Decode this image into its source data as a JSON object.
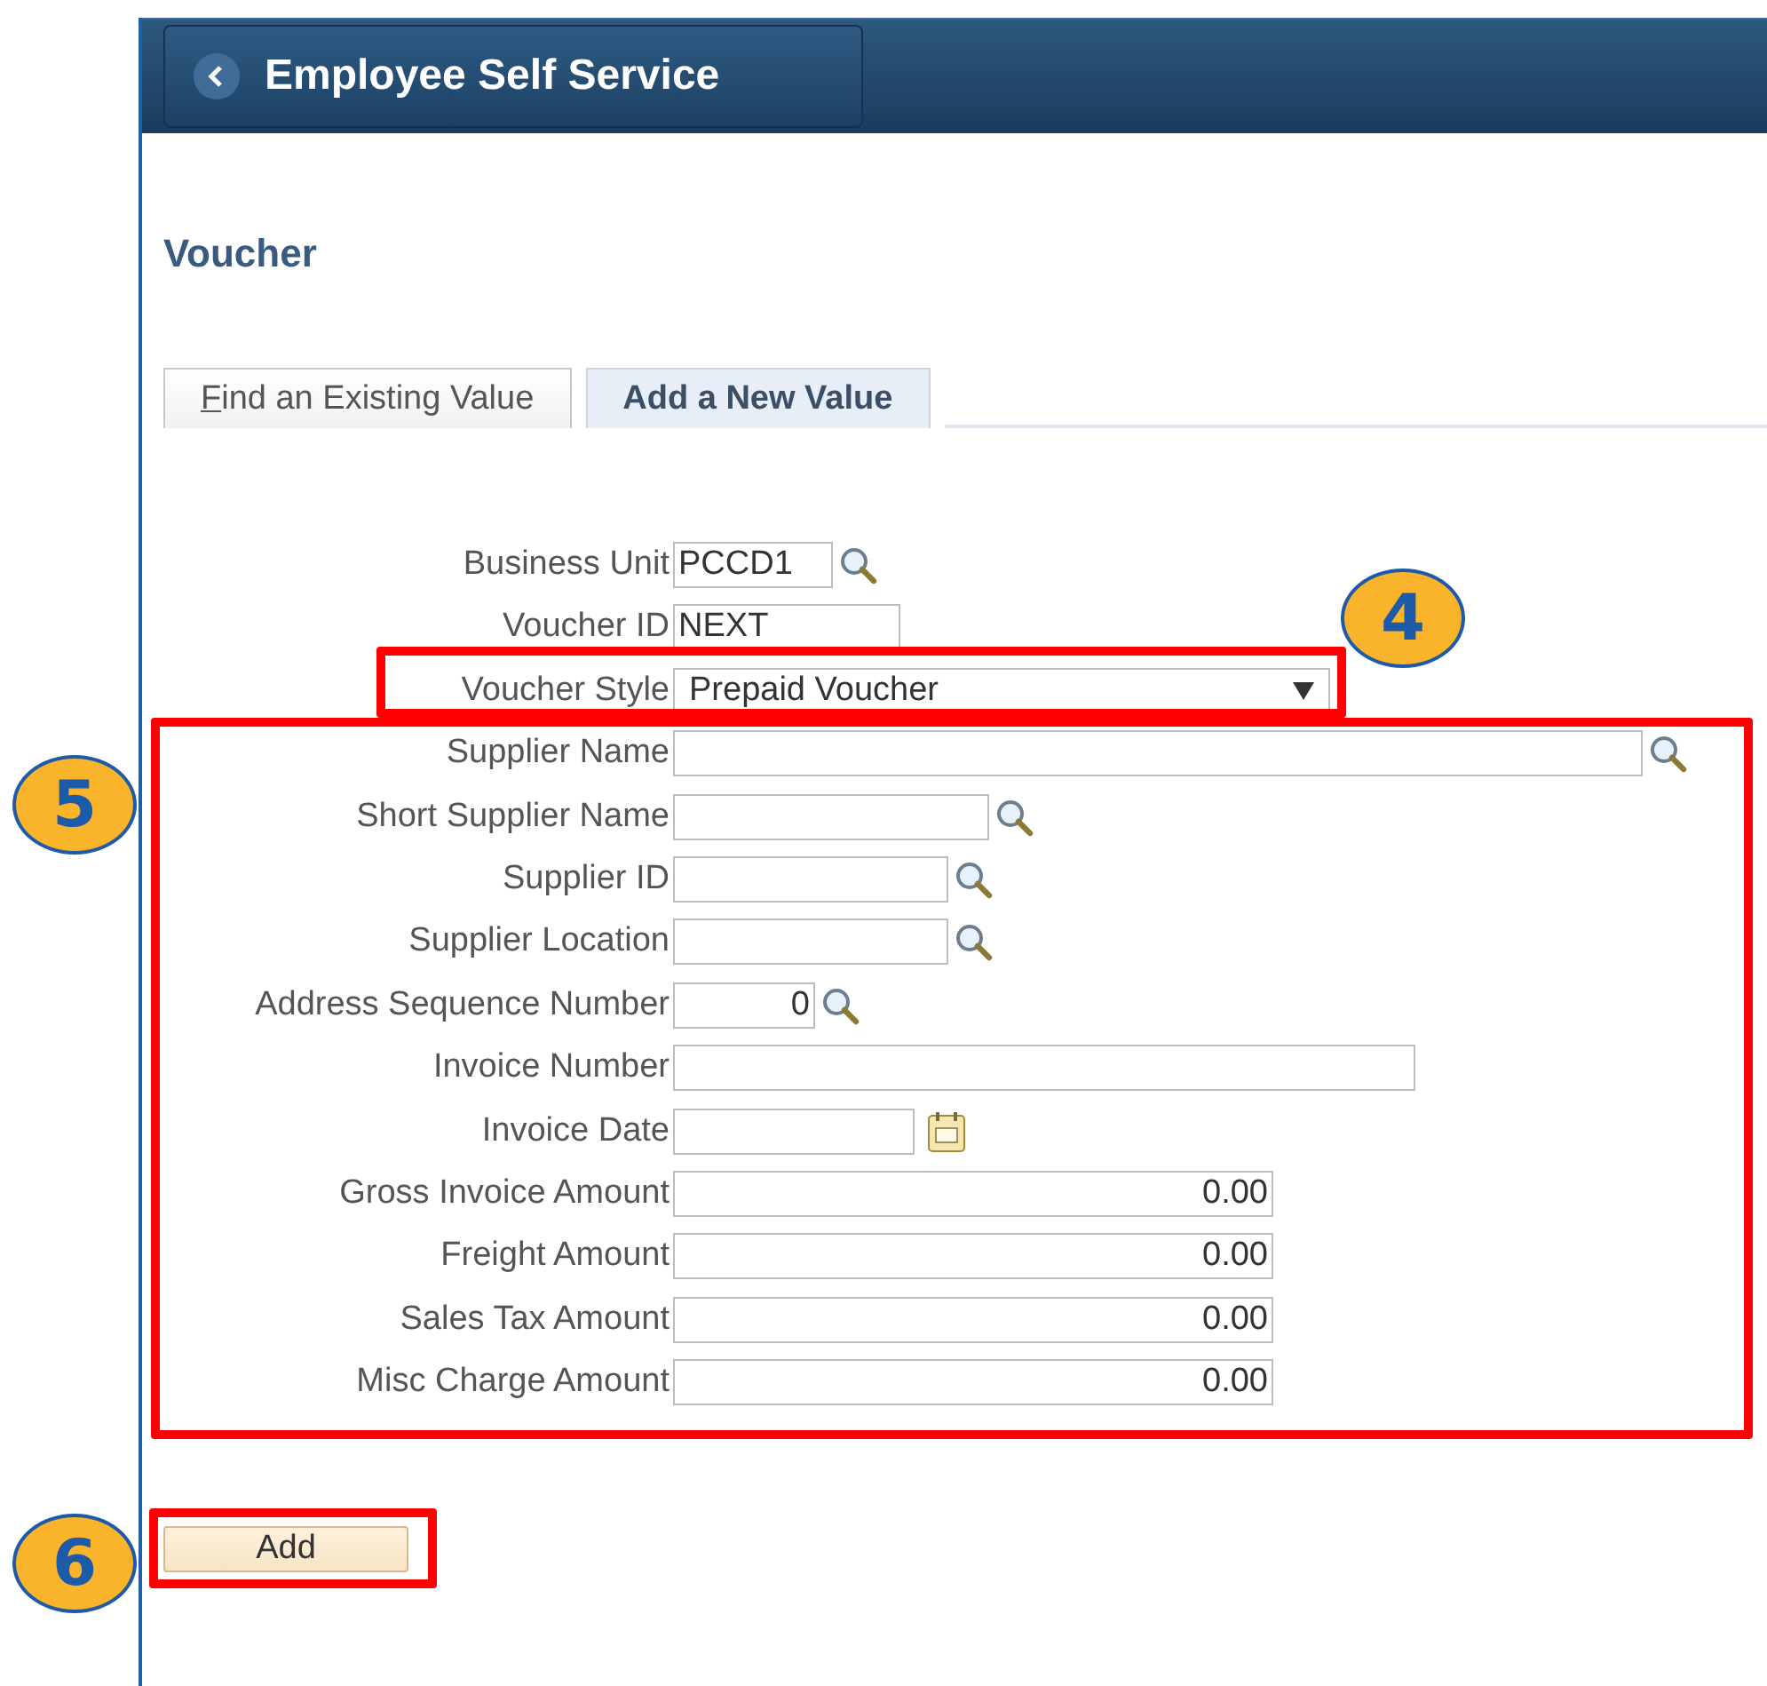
{
  "header": {
    "back_title": "Employee Self Service"
  },
  "page_title": "Voucher",
  "tabs": [
    {
      "label": "Find an Existing Value",
      "selected": false,
      "underline_first": true
    },
    {
      "label": "Add a New Value",
      "selected": true,
      "underline_first": false
    }
  ],
  "fields": [
    {
      "label": "Business Unit",
      "kind": "lookup",
      "value": "PCCD1"
    },
    {
      "label": "Voucher ID",
      "kind": "text",
      "value": "NEXT"
    },
    {
      "label": "Voucher Style",
      "kind": "select",
      "value": "Prepaid Voucher"
    },
    {
      "label": "Supplier Name",
      "kind": "lookup"
    },
    {
      "label": "Short Supplier Name",
      "kind": "lookup"
    },
    {
      "label": "Supplier ID",
      "kind": "lookup"
    },
    {
      "label": "Supplier Location",
      "kind": "lookup"
    },
    {
      "label": "Address Sequence Number",
      "kind": "number_lookup",
      "value": "0"
    },
    {
      "label": "Invoice Number",
      "kind": "text"
    },
    {
      "label": "Invoice Date",
      "kind": "date"
    },
    {
      "label": "Gross Invoice Amount",
      "kind": "amount",
      "value": "0.00"
    },
    {
      "label": "Freight Amount",
      "kind": "amount",
      "value": "0.00"
    },
    {
      "label": "Sales Tax Amount",
      "kind": "amount",
      "value": "0.00"
    },
    {
      "label": "Misc Charge Amount",
      "kind": "amount",
      "value": "0.00"
    }
  ],
  "add_button": "Add",
  "callouts": [
    {
      "label": "4"
    },
    {
      "label": "5"
    },
    {
      "label": "6"
    }
  ]
}
